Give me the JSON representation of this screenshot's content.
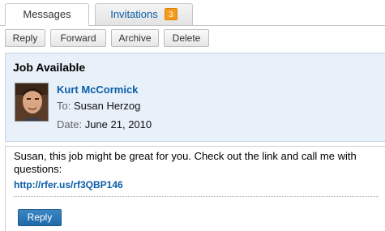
{
  "tabs": {
    "messages_label": "Messages",
    "invitations_label": "Invitations",
    "invitations_count": "3"
  },
  "toolbar": {
    "reply_label": "Reply",
    "forward_label": "Forward",
    "archive_label": "Archive",
    "delete_label": "Delete"
  },
  "message": {
    "subject": "Job Available",
    "sender_name": "Kurt McCormick",
    "to_label": "To:",
    "to_value": "Susan Herzog",
    "date_label": "Date:",
    "date_value": "June 21, 2010",
    "body_text": "Susan, this job might be great for you. Check out the link and call me with questions:",
    "link_text": "http://rfer.us/rf3QBP146",
    "reply_button_label": "Reply"
  },
  "colors": {
    "link_blue": "#0b5ea8",
    "header_bg": "#e8f0fa",
    "badge_orange": "#f29b1d",
    "primary_button": "#2a78b8"
  },
  "icons": {
    "avatar": "profile-photo"
  }
}
